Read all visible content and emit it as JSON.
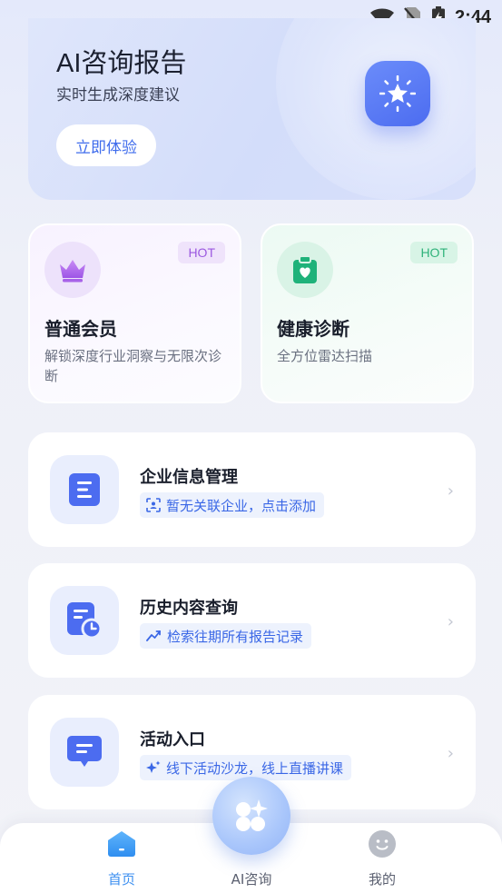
{
  "status_bar": {
    "time": "2:44"
  },
  "hero": {
    "title": "AI咨询报告",
    "subtitle": "实时生成深度建议",
    "cta_label": "立即体验",
    "badge_icon": "star-spark-icon"
  },
  "features": [
    {
      "title": "普通会员",
      "description": "解锁深度行业洞察与无限次诊断",
      "badge": "HOT",
      "icon": "crown-icon",
      "accent": "#9b58e0"
    },
    {
      "title": "健康诊断",
      "description": "全方位雷达扫描",
      "badge": "HOT",
      "icon": "clipboard-heart-icon",
      "accent": "#1fb27a"
    }
  ],
  "list": [
    {
      "title": "企业信息管理",
      "tag": "暂无关联企业，点击添加",
      "icon": "document-lines-icon",
      "tag_icon": "scan-face-icon"
    },
    {
      "title": "历史内容查询",
      "tag": "检索往期所有报告记录",
      "icon": "document-clock-icon",
      "tag_icon": "trend-icon"
    },
    {
      "title": "活动入口",
      "tag": "线下活动沙龙，线上直播讲课",
      "icon": "chat-bubble-icon",
      "tag_icon": "sparkle-icon"
    }
  ],
  "nav": {
    "home": "首页",
    "ai": "AI咨询",
    "me": "我的"
  },
  "colors": {
    "primary": "#4c6cf0",
    "nav_active": "#3c8ff0"
  }
}
